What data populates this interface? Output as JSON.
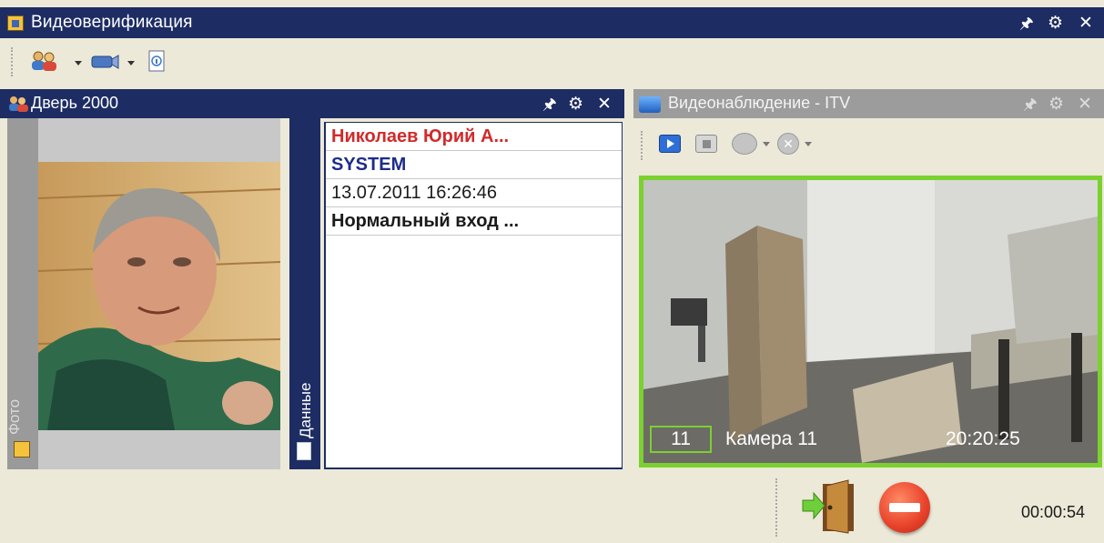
{
  "window": {
    "title": "Видеоверификация"
  },
  "toolbar": {
    "items": [
      {
        "icon": "users-icon",
        "has_dropdown": true
      },
      {
        "icon": "camera-icon",
        "has_dropdown": true
      },
      {
        "icon": "document-info-icon",
        "has_dropdown": false
      }
    ]
  },
  "door_panel": {
    "title": "Дверь 2000",
    "photo_tab_label": "Фото",
    "data_tab_label": "Данные",
    "data_rows": [
      {
        "text": "Николаев Юрий А...",
        "color": "#d12a2a"
      },
      {
        "text": "SYSTEM",
        "color": "#1d2c8a"
      },
      {
        "text": "13.07.2011 16:26:46",
        "color": "#1a1a1a"
      },
      {
        "text": "Нормальный вход ...",
        "color": "#1a1a1a"
      }
    ]
  },
  "video_panel": {
    "title": "Видеонаблюдение - ITV",
    "camera_number": "11",
    "camera_name": "Камера 11",
    "camera_time": "20:20:25",
    "controls": [
      "play-icon",
      "stop-icon",
      "record-icon",
      "cancel-icon"
    ]
  },
  "bottom": {
    "timer": "00:00:54",
    "actions": [
      "door-enter-icon",
      "deny-icon"
    ]
  },
  "colors": {
    "titlebar": "#1d2c63",
    "frame_highlight": "#7ad12f",
    "deny": "#e84a2a"
  }
}
